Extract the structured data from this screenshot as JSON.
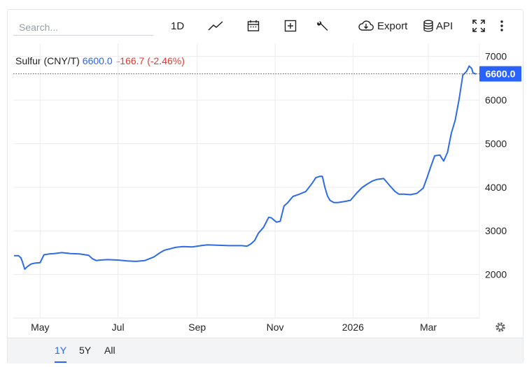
{
  "toolbar": {
    "search_placeholder": "Search...",
    "interval_label": "1D",
    "export_label": "Export",
    "api_label": "API"
  },
  "quote": {
    "symbol": "Sulfur (CNY/T)",
    "price": "6600.0",
    "change": "-166.7 (-2.46%)"
  },
  "last_price_label": "6600.0",
  "ranges": [
    {
      "label": "1Y",
      "active": true
    },
    {
      "label": "5Y",
      "active": false
    },
    {
      "label": "All",
      "active": false
    }
  ],
  "colors": {
    "line": "#2e6be6",
    "accent": "#2962ff",
    "negative": "#e53935"
  },
  "chart_data": {
    "type": "line",
    "xlabel": "",
    "ylabel": "",
    "x_tick_labels": [
      "May",
      "Jul",
      "Sep",
      "Nov",
      "2026",
      "Mar"
    ],
    "x_ticks": [
      "2025-05-01",
      "2025-07-01",
      "2025-09-01",
      "2025-11-01",
      "2026-01-01",
      "2026-03-01"
    ],
    "y_ticks": [
      2000,
      3000,
      4000,
      5000,
      6000,
      7000
    ],
    "xlim": [
      "2025-04-10",
      "2026-04-10"
    ],
    "ylim": [
      1000,
      7300
    ],
    "grid": true,
    "last_value": 6600.0,
    "series": [
      {
        "x": [
          "2025-04-11",
          "2025-04-14",
          "2025-04-16",
          "2025-04-17",
          "2025-04-19",
          "2025-04-21",
          "2025-04-24",
          "2025-04-27",
          "2025-05-01",
          "2025-05-04",
          "2025-05-06",
          "2025-05-08",
          "2025-05-12",
          "2025-05-18",
          "2025-05-25",
          "2025-06-01",
          "2025-06-08",
          "2025-06-11",
          "2025-06-14",
          "2025-06-17",
          "2025-06-23",
          "2025-07-01",
          "2025-07-08",
          "2025-07-15",
          "2025-07-22",
          "2025-07-29",
          "2025-08-03",
          "2025-08-06",
          "2025-08-08",
          "2025-08-11",
          "2025-08-15",
          "2025-08-21",
          "2025-08-28",
          "2025-09-04",
          "2025-09-09",
          "2025-09-16",
          "2025-09-26",
          "2025-10-06",
          "2025-10-10",
          "2025-10-13",
          "2025-10-16",
          "2025-10-19",
          "2025-10-23",
          "2025-10-27",
          "2025-10-29",
          "2025-11-02",
          "2025-11-05",
          "2025-11-08",
          "2025-11-11",
          "2025-11-15",
          "2025-11-20",
          "2025-11-25",
          "2025-11-30",
          "2025-12-03",
          "2025-12-06",
          "2025-12-08",
          "2025-12-10",
          "2025-12-12",
          "2025-12-14",
          "2025-12-17",
          "2025-12-20",
          "2025-12-25",
          "2025-12-30",
          "2026-01-04",
          "2026-01-08",
          "2026-01-12",
          "2026-01-16",
          "2026-01-20",
          "2026-01-25",
          "2026-01-30",
          "2026-02-03",
          "2026-02-06",
          "2026-02-10",
          "2026-02-15",
          "2026-02-20",
          "2026-02-25",
          "2026-02-28",
          "2026-03-03",
          "2026-03-06",
          "2026-03-10",
          "2026-03-13",
          "2026-03-16",
          "2026-03-19",
          "2026-03-22",
          "2026-03-25",
          "2026-03-28",
          "2026-03-31",
          "2026-04-02",
          "2026-04-04",
          "2026-04-05",
          "2026-04-06",
          "2026-04-07"
        ],
        "y": [
          2430,
          2430,
          2380,
          2300,
          2120,
          2180,
          2240,
          2260,
          2270,
          2450,
          2460,
          2470,
          2480,
          2500,
          2480,
          2470,
          2440,
          2360,
          2320,
          2330,
          2340,
          2330,
          2310,
          2300,
          2320,
          2400,
          2500,
          2550,
          2570,
          2590,
          2620,
          2640,
          2630,
          2660,
          2680,
          2670,
          2660,
          2660,
          2650,
          2700,
          2780,
          2950,
          3080,
          3310,
          3300,
          3200,
          3220,
          3570,
          3650,
          3790,
          3840,
          3900,
          4090,
          4220,
          4250,
          4250,
          4000,
          3800,
          3700,
          3650,
          3650,
          3670,
          3700,
          3870,
          3990,
          4070,
          4140,
          4180,
          4200,
          4030,
          3900,
          3840,
          3840,
          3830,
          3860,
          3980,
          4220,
          4480,
          4720,
          4740,
          4600,
          4800,
          5240,
          5530,
          6000,
          6570,
          6660,
          6780,
          6720,
          6620,
          6610,
          6600
        ]
      }
    ]
  }
}
